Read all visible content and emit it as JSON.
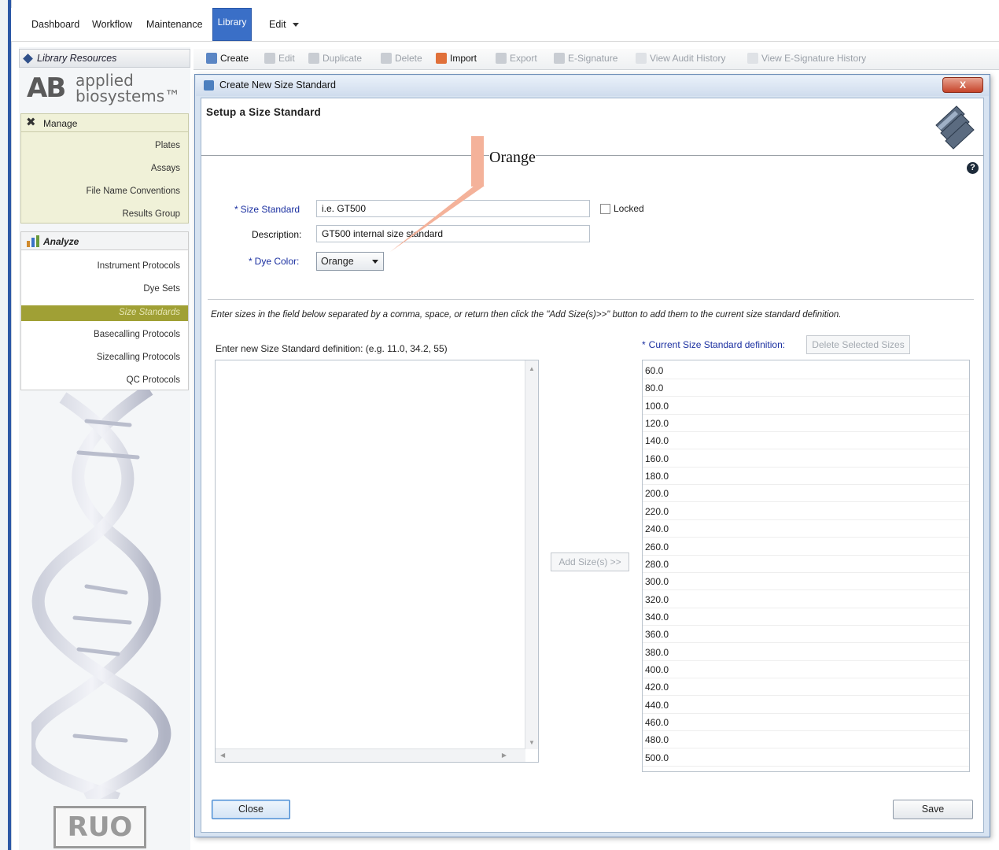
{
  "menu": {
    "items": [
      "Dashboard",
      "Workflow",
      "Maintenance"
    ],
    "active": "Library",
    "edit": "Edit"
  },
  "sidebar": {
    "library_resources": "Library Resources",
    "logo": {
      "mark": "AB",
      "line1": "applied",
      "line2": "biosystems™"
    },
    "manage": {
      "title": "Manage",
      "items": [
        "Plates",
        "Assays",
        "File Name Conventions",
        "Results Group"
      ]
    },
    "analyze": {
      "title": "Analyze",
      "items": [
        "Instrument Protocols",
        "Dye Sets",
        "Size Standards",
        "Basecalling Protocols",
        "Sizecalling Protocols",
        "QC Protocols"
      ],
      "selected": "Size Standards"
    },
    "ruo": "RUO"
  },
  "toolbar": {
    "create": "Create",
    "edit": "Edit",
    "duplicate": "Duplicate",
    "delete": "Delete",
    "import": "Import",
    "export": "Export",
    "esignature": "E-Signature",
    "view_audit": "View Audit History",
    "view_esig": "View E-Signature History"
  },
  "dialog": {
    "title": "Create New Size Standard",
    "close_x": "X",
    "header": "Setup a Size Standard",
    "help": "?",
    "size_standard_label": "Size Standard",
    "size_standard_value": "i.e. GT500",
    "locked_label": "Locked",
    "description_label": "Description:",
    "description_value": "GT500 internal size standard",
    "dye_color_label": "Dye Color:",
    "dye_color_value": "Orange",
    "instructions": "Enter sizes in the field below separated by a comma, space, or return then click the \"Add Size(s)>>\" button to add them to the current size standard definition.",
    "enter_label": "Enter new Size Standard definition: (e.g. 11.0, 34.2, 55)",
    "add_button": "Add Size(s) >>",
    "current_label": "Current Size Standard definition:",
    "delete_button": "Delete Selected Sizes",
    "sizes": [
      "60.0",
      "80.0",
      "100.0",
      "120.0",
      "140.0",
      "160.0",
      "180.0",
      "200.0",
      "220.0",
      "240.0",
      "260.0",
      "280.0",
      "300.0",
      "320.0",
      "340.0",
      "360.0",
      "380.0",
      "400.0",
      "420.0",
      "440.0",
      "460.0",
      "480.0",
      "500.0"
    ],
    "close_button": "Close",
    "save_button": "Save"
  },
  "annotation": {
    "text": "Orange",
    "color": "#f4b29a"
  },
  "icons": {
    "library_resources": "diamond-icon",
    "manage": "tools-icon",
    "analyze": "bar-chart-icon",
    "dialog": "size-standard-icon",
    "header": "stacked-plates-icon",
    "help": "help-icon"
  }
}
